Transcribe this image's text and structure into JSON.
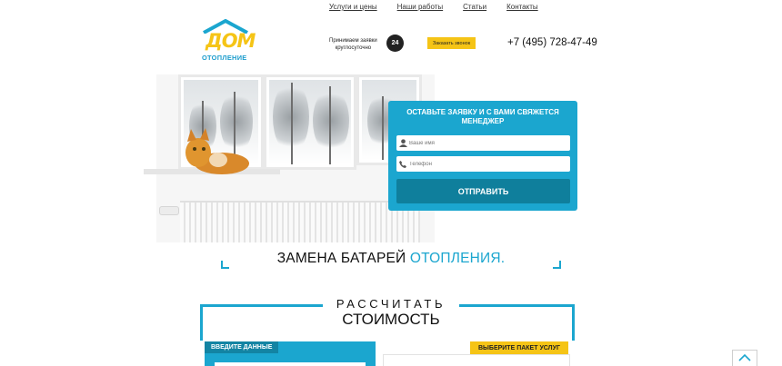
{
  "nav": {
    "items": [
      "Услуги и цены",
      "Наши работы",
      "Статьи",
      "Контакты"
    ]
  },
  "logo": {
    "word1": "ДОМ",
    "word2": "ОТОПЛЕНИЕ"
  },
  "header": {
    "accept_line1": "Принимаем заявки",
    "accept_line2": "круглосуточно",
    "badge": "24",
    "callback_label": "Заказать звонок",
    "phone": "+7 (495) 728-47-49"
  },
  "form": {
    "title_line1": "ОСТАВЬТЕ ЗАЯВКУ И С ВАМИ СВЯЖЕТСЯ",
    "title_line2": "МЕНЕДЖЕР",
    "name_placeholder": "Ваше имя",
    "phone_placeholder": "Телефон",
    "submit_label": "ОТПРАВИТЬ"
  },
  "slogan": {
    "part1": "ЗАМЕНА БАТАРЕЙ",
    "part2": "ОТОПЛЕНИЯ."
  },
  "calc": {
    "line1": "РАССЧИТАТЬ",
    "line2": "СТОИМОСТЬ",
    "enter_tab": "ВВЕДИТЕ ДАННЫЕ",
    "package_tab": "ВЫБЕРИТЕ ПАКЕТ УСЛУГ"
  },
  "colors": {
    "accent_blue": "#1ba6cf",
    "accent_yellow": "#f5c416",
    "dark_blue": "#0f7f9c"
  },
  "icons": {
    "user": "user-icon",
    "phone": "phone-icon",
    "clock": "clock-24-icon",
    "scroll": "chevron-up-icon"
  }
}
